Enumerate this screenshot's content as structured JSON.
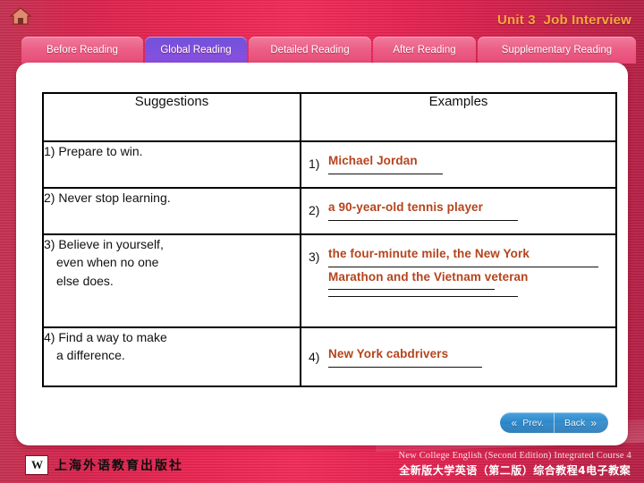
{
  "header": {
    "home_icon": "home-icon",
    "unit_title": "Unit 3  Job Interview"
  },
  "tabs": [
    {
      "label": "Before Reading",
      "active": false
    },
    {
      "label": "Global Reading",
      "active": true
    },
    {
      "label": "Detailed Reading",
      "active": false
    },
    {
      "label": "After Reading",
      "active": false
    },
    {
      "label": "Supplementary Reading",
      "active": false
    }
  ],
  "table": {
    "headers": [
      "Suggestions",
      "Examples"
    ],
    "rows": [
      {
        "suggestion": "1) Prepare to win.",
        "suggestion_line2": "",
        "suggestion_line3": "",
        "example_num": "1)",
        "answer_lines": [
          "Michael Jordan"
        ],
        "blank_lines": 0
      },
      {
        "suggestion": "2) Never stop learning.",
        "suggestion_line2": "",
        "suggestion_line3": "",
        "example_num": "2)",
        "answer_lines": [
          "a 90-year-old tennis player"
        ],
        "blank_lines": 0
      },
      {
        "suggestion": "3) Believe in yourself,",
        "suggestion_line2": "even when no one",
        "suggestion_line3": "else does.",
        "example_num": "3)",
        "answer_lines": [
          "the four-minute mile, the New York",
          "Marathon and the Vietnam veteran"
        ],
        "blank_lines": 1
      },
      {
        "suggestion": "4) Find a way to make",
        "suggestion_line2": "a difference.",
        "suggestion_line3": "",
        "example_num": "4)",
        "answer_lines": [
          "New York cabdrivers"
        ],
        "blank_lines": 0
      }
    ]
  },
  "nav": {
    "prev_label": "Prev.",
    "prev_icon": "double-chevron-left-icon",
    "back_label": "Back",
    "back_icon": "double-chevron-right-icon"
  },
  "footer": {
    "publisher_logo": "W",
    "publisher_name": "上海外语教育出版社",
    "course_en": "New College English (Second Edition) Integrated Course 4",
    "course_cn": "全新版大学英语（第二版）综合教程4电子教案"
  },
  "colors": {
    "background_pink": "#e8234f",
    "tab_pink": "#ec5f87",
    "tab_active_purple": "#7b50dd",
    "title_gold": "#f6a83c",
    "answer_brown": "#b5441c",
    "nav_blue": "#2a86c8"
  }
}
